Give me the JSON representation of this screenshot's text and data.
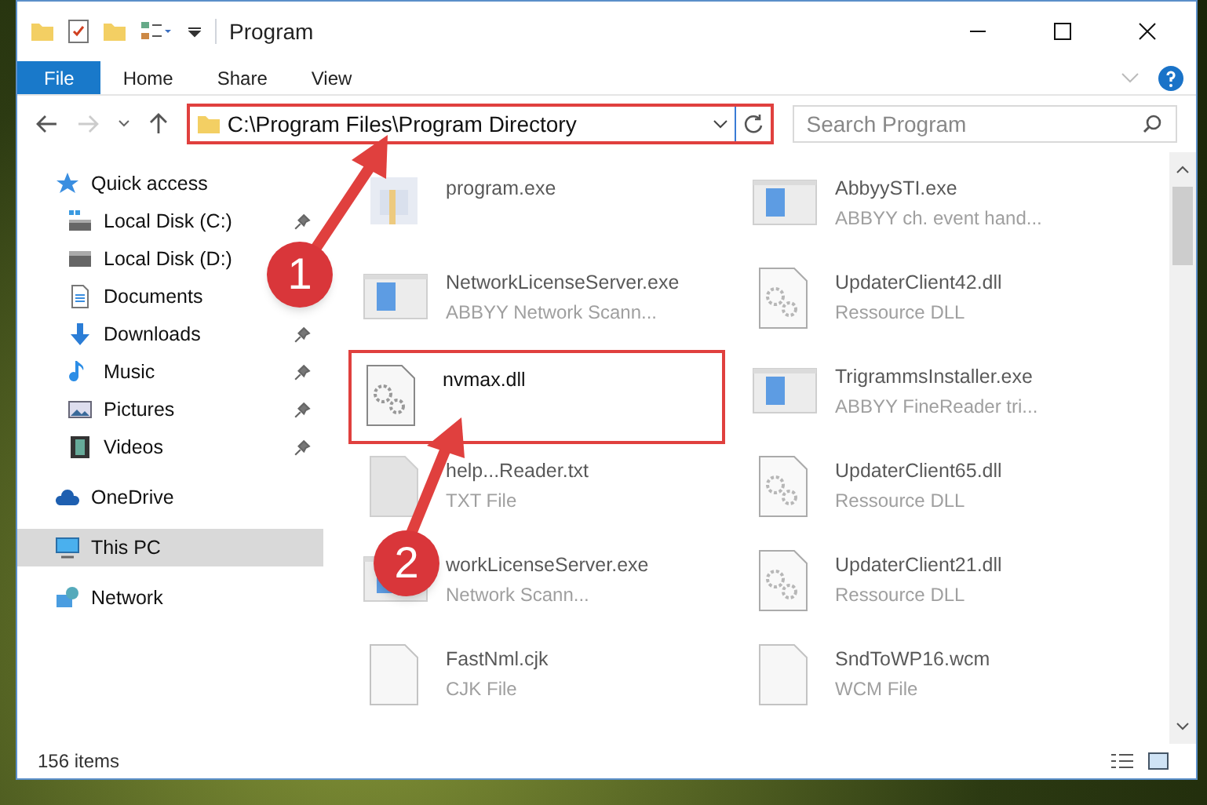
{
  "window": {
    "title": "Program"
  },
  "ribbon": {
    "tabs": [
      {
        "label": "File",
        "selected": true
      },
      {
        "label": "Home",
        "selected": false
      },
      {
        "label": "Share",
        "selected": false
      },
      {
        "label": "View",
        "selected": false
      }
    ]
  },
  "address_bar": {
    "path": "C:\\Program Files\\Program Directory",
    "highlighted": true
  },
  "search": {
    "placeholder": "Search Program"
  },
  "sidebar": {
    "items": [
      {
        "label": "Quick access",
        "selected": false,
        "children": [
          {
            "label": "Local Disk (C:)",
            "pinned": true,
            "selected": false
          },
          {
            "label": "Local Disk (D:)",
            "pinned": false,
            "selected": false
          },
          {
            "label": "Documents",
            "pinned": false,
            "selected": false
          },
          {
            "label": "Downloads",
            "pinned": true,
            "selected": false
          },
          {
            "label": "Music",
            "pinned": true,
            "selected": false
          },
          {
            "label": "Pictures",
            "pinned": true,
            "selected": false
          },
          {
            "label": "Videos",
            "pinned": true,
            "selected": false
          }
        ]
      },
      {
        "label": "OneDrive",
        "selected": false
      },
      {
        "label": "This PC",
        "selected": true
      },
      {
        "label": "Network",
        "selected": false
      }
    ]
  },
  "files": [
    {
      "name": "program.exe",
      "kind": "program",
      "highlighted": false
    },
    {
      "name": "AbbyySTI.exe",
      "type": "ABBYY ch. event hand...",
      "kind": "app",
      "highlighted": false
    },
    {
      "name": "NetworkLicenseServer.exe",
      "type": "ABBYY Network Scann...",
      "kind": "app",
      "highlighted": false
    },
    {
      "name": "UpdaterClient42.dll",
      "type": "Ressource DLL",
      "kind": "dll",
      "highlighted": false
    },
    {
      "name": "nvmax.dll",
      "kind": "dll",
      "highlighted": true
    },
    {
      "name": "TrigrammsInstaller.exe",
      "type": "ABBYY FineReader tri...",
      "kind": "app",
      "highlighted": false
    },
    {
      "name": "help...Reader.txt",
      "type": "TXT File",
      "kind": "text",
      "highlighted": false
    },
    {
      "name": "UpdaterClient65.dll",
      "type": "Ressource DLL",
      "kind": "dll",
      "highlighted": false
    },
    {
      "name": "workLicenseServer.exe",
      "type": "Network Scann...",
      "kind": "app",
      "highlighted": false
    },
    {
      "name": "UpdaterClient21.dll",
      "type": "Ressource DLL",
      "kind": "dll",
      "highlighted": false
    },
    {
      "name": "FastNml.cjk",
      "type": "CJK File",
      "kind": "blank",
      "highlighted": false
    },
    {
      "name": "SndToWP16.wcm",
      "type": "WCM File",
      "kind": "blank",
      "highlighted": false
    }
  ],
  "status_bar": {
    "count": "156 items"
  },
  "annotations": [
    {
      "number": "1"
    },
    {
      "number": "2"
    }
  ]
}
